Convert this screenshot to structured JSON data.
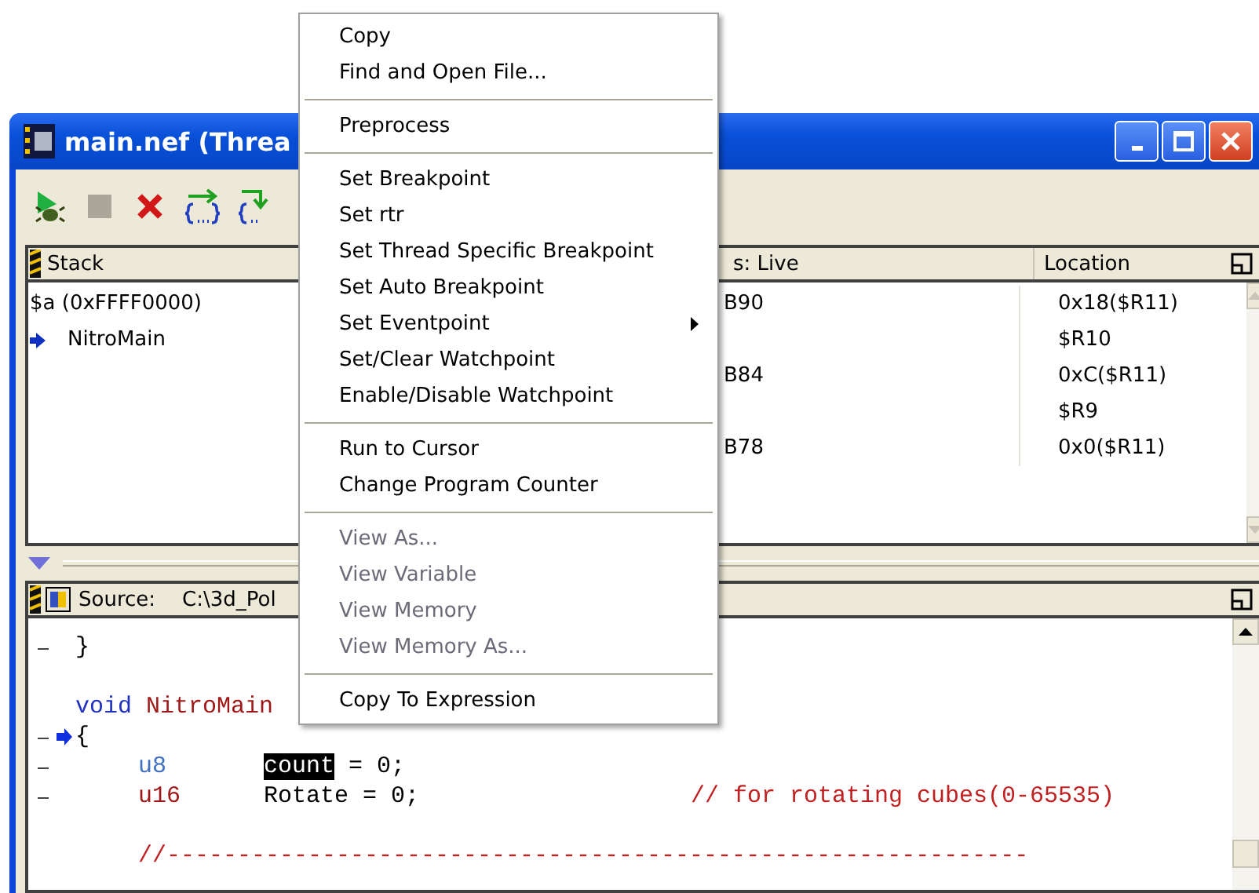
{
  "window": {
    "title": "main.nef (Threa"
  },
  "stack_pane": {
    "columns": [
      "Stack",
      "s: Live",
      "Location"
    ],
    "rows": [
      {
        "frame": "$a (0xFFFF0000)",
        "current": false,
        "column_2": "B90",
        "location": "0x18($R11)"
      },
      {
        "frame": "NitroMain",
        "current": true,
        "location": "$R10"
      },
      {
        "column_2": "B84",
        "current": false,
        "location": "0xC($R11)"
      },
      {
        "current": false,
        "location": "$R9"
      },
      {
        "column_2": "B78",
        "current": false,
        "location": "0x0($R11)"
      }
    ]
  },
  "source_pane": {
    "label": "Source:",
    "path": "C:\\3d_Pol",
    "lines": [
      {
        "kind": "code",
        "marker": true,
        "current": false,
        "segments": [
          {
            "kind": "plain",
            "text": "}"
          }
        ]
      },
      {
        "kind": "blank",
        "marker": false,
        "current": false
      },
      {
        "kind": "code",
        "marker": false,
        "current": false,
        "segments": [
          {
            "kind": "keyword",
            "text": "void"
          },
          {
            "kind": "ident",
            "text": "NitroMain"
          }
        ]
      },
      {
        "kind": "code",
        "marker": true,
        "current": true,
        "segments": [
          {
            "kind": "plain",
            "text": "{"
          }
        ]
      },
      {
        "kind": "decl",
        "marker": true,
        "current": false,
        "type": {
          "kind": "type",
          "text": "u8"
        },
        "name": [
          {
            "kind": "selected",
            "text": "count"
          },
          {
            "kind": "plain",
            "text": "= 0;"
          }
        ]
      },
      {
        "kind": "decl",
        "marker": true,
        "current": false,
        "type": {
          "kind": "ident",
          "text": "u16"
        },
        "name": [
          {
            "kind": "plain",
            "text": "Rotate = 0;"
          }
        ],
        "comment": "// for rotating cubes(0-65535)"
      },
      {
        "kind": "blank",
        "marker": false,
        "current": false
      },
      {
        "kind": "comment",
        "marker": false,
        "current": false,
        "text": "//-------------------------------------------------------------"
      }
    ]
  },
  "context_menu": {
    "items": [
      {
        "kind": "item",
        "label": "Copy",
        "disabled": false,
        "submenu": false
      },
      {
        "kind": "item",
        "label": "Find and Open File...",
        "disabled": false,
        "submenu": false
      },
      {
        "kind": "separator"
      },
      {
        "kind": "item",
        "label": "Preprocess",
        "disabled": false,
        "submenu": false
      },
      {
        "kind": "separator"
      },
      {
        "kind": "item",
        "label": "Set Breakpoint",
        "disabled": false,
        "submenu": false
      },
      {
        "kind": "item",
        "label": "Set rtr",
        "disabled": false,
        "submenu": false
      },
      {
        "kind": "item",
        "label": "Set Thread Specific Breakpoint",
        "disabled": false,
        "submenu": false
      },
      {
        "kind": "item",
        "label": "Set Auto Breakpoint",
        "disabled": false,
        "submenu": false
      },
      {
        "kind": "item",
        "label": "Set Eventpoint",
        "disabled": false,
        "submenu": true
      },
      {
        "kind": "item",
        "label": "Set/Clear Watchpoint",
        "disabled": false,
        "submenu": false
      },
      {
        "kind": "item",
        "label": "Enable/Disable Watchpoint",
        "disabled": false,
        "submenu": false
      },
      {
        "kind": "separator"
      },
      {
        "kind": "item",
        "label": "Run to Cursor",
        "disabled": false,
        "submenu": false
      },
      {
        "kind": "item",
        "label": "Change Program Counter",
        "disabled": false,
        "submenu": false
      },
      {
        "kind": "separator"
      },
      {
        "kind": "item",
        "label": "View As...",
        "disabled": true,
        "submenu": false
      },
      {
        "kind": "item",
        "label": "View Variable",
        "disabled": true,
        "submenu": false
      },
      {
        "kind": "item",
        "label": "View Memory",
        "disabled": true,
        "submenu": false
      },
      {
        "kind": "item",
        "label": "View Memory As...",
        "disabled": true,
        "submenu": false
      },
      {
        "kind": "separator"
      },
      {
        "kind": "item",
        "label": "Copy To Expression",
        "disabled": false,
        "submenu": false
      }
    ]
  }
}
